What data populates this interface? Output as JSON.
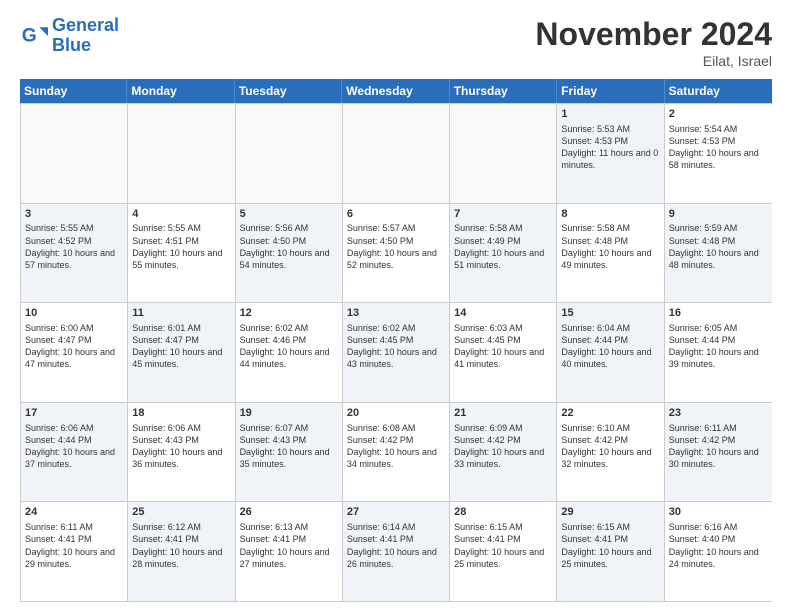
{
  "logo": {
    "line1": "General",
    "line2": "Blue"
  },
  "title": "November 2024",
  "location": "Eilat, Israel",
  "weekdays": [
    "Sunday",
    "Monday",
    "Tuesday",
    "Wednesday",
    "Thursday",
    "Friday",
    "Saturday"
  ],
  "rows": [
    [
      {
        "day": "",
        "info": "",
        "shaded": false,
        "empty": true
      },
      {
        "day": "",
        "info": "",
        "shaded": false,
        "empty": true
      },
      {
        "day": "",
        "info": "",
        "shaded": false,
        "empty": true
      },
      {
        "day": "",
        "info": "",
        "shaded": false,
        "empty": true
      },
      {
        "day": "",
        "info": "",
        "shaded": false,
        "empty": true
      },
      {
        "day": "1",
        "info": "Sunrise: 5:53 AM\nSunset: 4:53 PM\nDaylight: 11 hours and 0 minutes.",
        "shaded": true,
        "empty": false
      },
      {
        "day": "2",
        "info": "Sunrise: 5:54 AM\nSunset: 4:53 PM\nDaylight: 10 hours and 58 minutes.",
        "shaded": false,
        "empty": false
      }
    ],
    [
      {
        "day": "3",
        "info": "Sunrise: 5:55 AM\nSunset: 4:52 PM\nDaylight: 10 hours and 57 minutes.",
        "shaded": true,
        "empty": false
      },
      {
        "day": "4",
        "info": "Sunrise: 5:55 AM\nSunset: 4:51 PM\nDaylight: 10 hours and 55 minutes.",
        "shaded": false,
        "empty": false
      },
      {
        "day": "5",
        "info": "Sunrise: 5:56 AM\nSunset: 4:50 PM\nDaylight: 10 hours and 54 minutes.",
        "shaded": true,
        "empty": false
      },
      {
        "day": "6",
        "info": "Sunrise: 5:57 AM\nSunset: 4:50 PM\nDaylight: 10 hours and 52 minutes.",
        "shaded": false,
        "empty": false
      },
      {
        "day": "7",
        "info": "Sunrise: 5:58 AM\nSunset: 4:49 PM\nDaylight: 10 hours and 51 minutes.",
        "shaded": true,
        "empty": false
      },
      {
        "day": "8",
        "info": "Sunrise: 5:58 AM\nSunset: 4:48 PM\nDaylight: 10 hours and 49 minutes.",
        "shaded": false,
        "empty": false
      },
      {
        "day": "9",
        "info": "Sunrise: 5:59 AM\nSunset: 4:48 PM\nDaylight: 10 hours and 48 minutes.",
        "shaded": true,
        "empty": false
      }
    ],
    [
      {
        "day": "10",
        "info": "Sunrise: 6:00 AM\nSunset: 4:47 PM\nDaylight: 10 hours and 47 minutes.",
        "shaded": false,
        "empty": false
      },
      {
        "day": "11",
        "info": "Sunrise: 6:01 AM\nSunset: 4:47 PM\nDaylight: 10 hours and 45 minutes.",
        "shaded": true,
        "empty": false
      },
      {
        "day": "12",
        "info": "Sunrise: 6:02 AM\nSunset: 4:46 PM\nDaylight: 10 hours and 44 minutes.",
        "shaded": false,
        "empty": false
      },
      {
        "day": "13",
        "info": "Sunrise: 6:02 AM\nSunset: 4:45 PM\nDaylight: 10 hours and 43 minutes.",
        "shaded": true,
        "empty": false
      },
      {
        "day": "14",
        "info": "Sunrise: 6:03 AM\nSunset: 4:45 PM\nDaylight: 10 hours and 41 minutes.",
        "shaded": false,
        "empty": false
      },
      {
        "day": "15",
        "info": "Sunrise: 6:04 AM\nSunset: 4:44 PM\nDaylight: 10 hours and 40 minutes.",
        "shaded": true,
        "empty": false
      },
      {
        "day": "16",
        "info": "Sunrise: 6:05 AM\nSunset: 4:44 PM\nDaylight: 10 hours and 39 minutes.",
        "shaded": false,
        "empty": false
      }
    ],
    [
      {
        "day": "17",
        "info": "Sunrise: 6:06 AM\nSunset: 4:44 PM\nDaylight: 10 hours and 37 minutes.",
        "shaded": true,
        "empty": false
      },
      {
        "day": "18",
        "info": "Sunrise: 6:06 AM\nSunset: 4:43 PM\nDaylight: 10 hours and 36 minutes.",
        "shaded": false,
        "empty": false
      },
      {
        "day": "19",
        "info": "Sunrise: 6:07 AM\nSunset: 4:43 PM\nDaylight: 10 hours and 35 minutes.",
        "shaded": true,
        "empty": false
      },
      {
        "day": "20",
        "info": "Sunrise: 6:08 AM\nSunset: 4:42 PM\nDaylight: 10 hours and 34 minutes.",
        "shaded": false,
        "empty": false
      },
      {
        "day": "21",
        "info": "Sunrise: 6:09 AM\nSunset: 4:42 PM\nDaylight: 10 hours and 33 minutes.",
        "shaded": true,
        "empty": false
      },
      {
        "day": "22",
        "info": "Sunrise: 6:10 AM\nSunset: 4:42 PM\nDaylight: 10 hours and 32 minutes.",
        "shaded": false,
        "empty": false
      },
      {
        "day": "23",
        "info": "Sunrise: 6:11 AM\nSunset: 4:42 PM\nDaylight: 10 hours and 30 minutes.",
        "shaded": true,
        "empty": false
      }
    ],
    [
      {
        "day": "24",
        "info": "Sunrise: 6:11 AM\nSunset: 4:41 PM\nDaylight: 10 hours and 29 minutes.",
        "shaded": false,
        "empty": false
      },
      {
        "day": "25",
        "info": "Sunrise: 6:12 AM\nSunset: 4:41 PM\nDaylight: 10 hours and 28 minutes.",
        "shaded": true,
        "empty": false
      },
      {
        "day": "26",
        "info": "Sunrise: 6:13 AM\nSunset: 4:41 PM\nDaylight: 10 hours and 27 minutes.",
        "shaded": false,
        "empty": false
      },
      {
        "day": "27",
        "info": "Sunrise: 6:14 AM\nSunset: 4:41 PM\nDaylight: 10 hours and 26 minutes.",
        "shaded": true,
        "empty": false
      },
      {
        "day": "28",
        "info": "Sunrise: 6:15 AM\nSunset: 4:41 PM\nDaylight: 10 hours and 25 minutes.",
        "shaded": false,
        "empty": false
      },
      {
        "day": "29",
        "info": "Sunrise: 6:15 AM\nSunset: 4:41 PM\nDaylight: 10 hours and 25 minutes.",
        "shaded": true,
        "empty": false
      },
      {
        "day": "30",
        "info": "Sunrise: 6:16 AM\nSunset: 4:40 PM\nDaylight: 10 hours and 24 minutes.",
        "shaded": false,
        "empty": false
      }
    ]
  ]
}
